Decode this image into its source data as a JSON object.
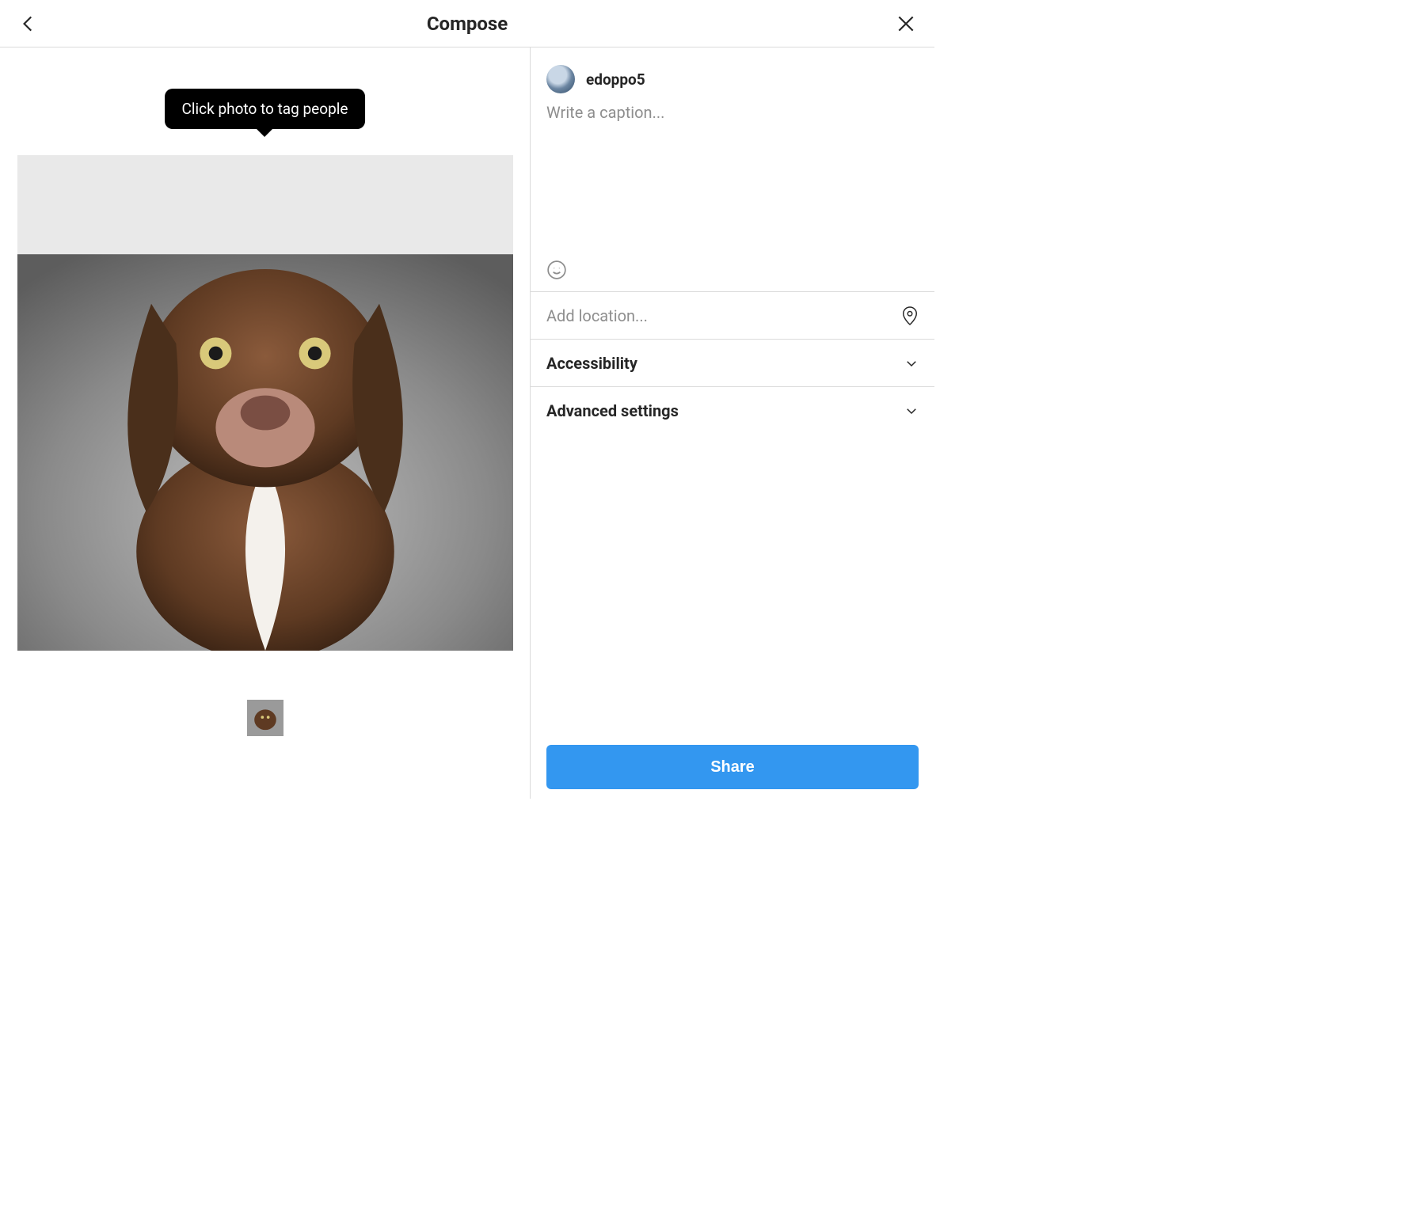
{
  "header": {
    "title": "Compose"
  },
  "tooltip": {
    "text": "Click photo to tag people"
  },
  "user": {
    "username": "edoppo5"
  },
  "caption": {
    "placeholder": "Write a caption..."
  },
  "location": {
    "placeholder": "Add location..."
  },
  "rows": {
    "accessibility": "Accessibility",
    "advanced": "Advanced settings"
  },
  "share": {
    "label": "Share"
  },
  "colors": {
    "primary": "#3397f0",
    "border": "#dbdbdb",
    "muted": "#8e8e8e"
  }
}
